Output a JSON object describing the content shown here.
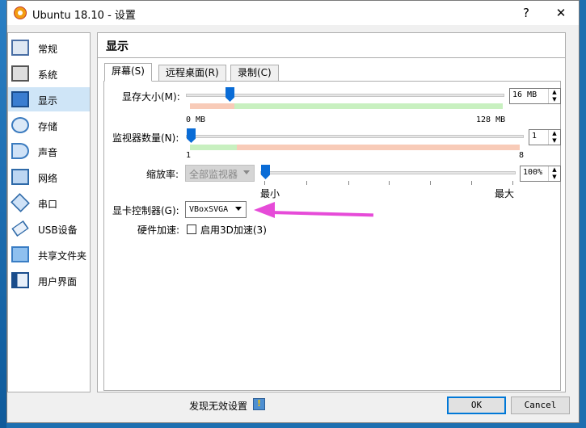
{
  "window": {
    "title": "Ubuntu 18.10 - 设置",
    "help": "?",
    "close": "✕"
  },
  "sidebar": {
    "items": [
      {
        "label": "常规",
        "icon": "general-icon"
      },
      {
        "label": "系统",
        "icon": "system-icon"
      },
      {
        "label": "显示",
        "icon": "display-icon",
        "selected": true
      },
      {
        "label": "存储",
        "icon": "storage-icon"
      },
      {
        "label": "声音",
        "icon": "audio-icon"
      },
      {
        "label": "网络",
        "icon": "network-icon"
      },
      {
        "label": "串口",
        "icon": "serial-port-icon"
      },
      {
        "label": "USB设备",
        "icon": "usb-icon"
      },
      {
        "label": "共享文件夹",
        "icon": "shared-folder-icon"
      },
      {
        "label": "用户界面",
        "icon": "user-interface-icon"
      }
    ]
  },
  "section": {
    "title": "显示"
  },
  "tabs": [
    {
      "label": "屏幕(S)",
      "active": true
    },
    {
      "label": "远程桌面(R)"
    },
    {
      "label": "录制(C)"
    }
  ],
  "screen": {
    "video_memory": {
      "label": "显存大小(M):",
      "value": "16 MB",
      "min_label": "0 MB",
      "max_label": "128 MB",
      "level": 0.125
    },
    "monitor_count": {
      "label": "监视器数量(N):",
      "value": "1",
      "min_label": "1",
      "max_label": "8",
      "level": 0
    },
    "scale": {
      "label": "缩放率:",
      "combo": "全部监视器",
      "value": "100%",
      "min_label": "最小",
      "max_label": "最大",
      "level": 0
    },
    "controller": {
      "label": "显卡控制器(G):",
      "value": "VBoxSVGA"
    },
    "acceleration": {
      "label": "硬件加速:",
      "checkbox_label": "启用3D加速(3)",
      "checked": false
    }
  },
  "footer": {
    "warning": "发现无效设置",
    "ok": "OK",
    "cancel": "Cancel"
  },
  "colors": {
    "accent": "#0a6cd6",
    "annotation_arrow": "#e64bd8",
    "selected_item": "#cfe5f7"
  }
}
